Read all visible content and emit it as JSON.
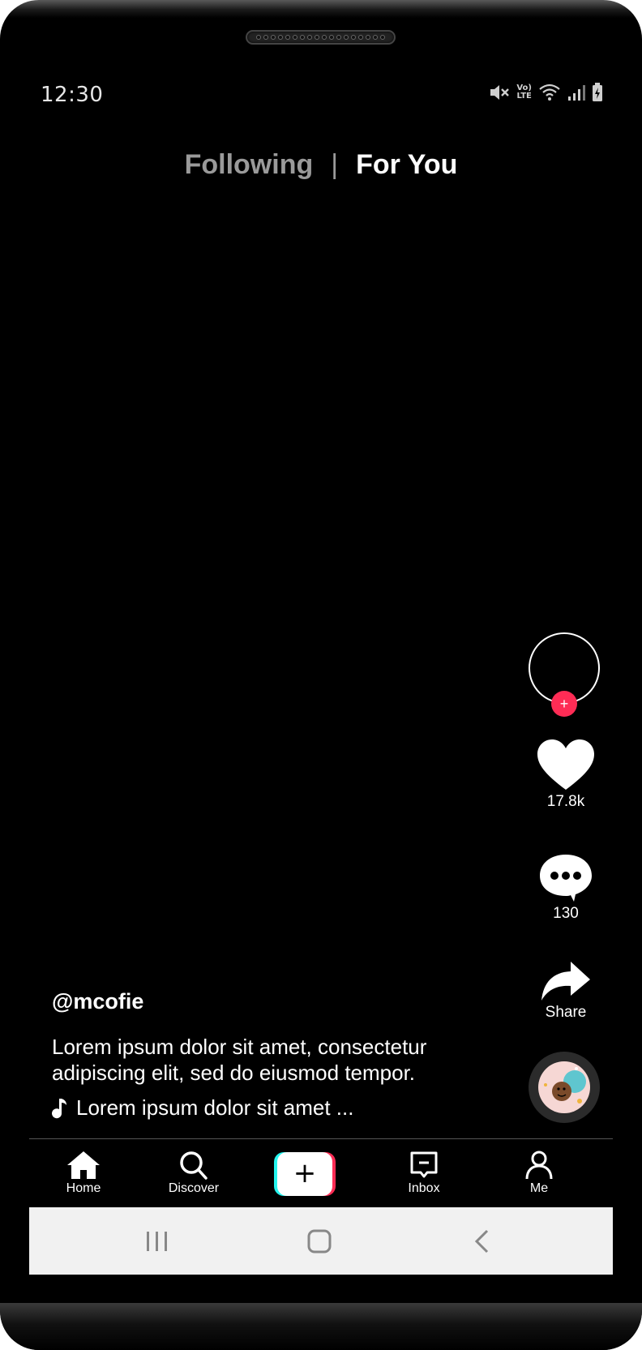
{
  "status_bar": {
    "time": "12:30",
    "volte_top": "Vo)",
    "volte_bottom": "LTE",
    "icons": [
      "mute-icon",
      "volte-icon",
      "wifi-icon",
      "signal-icon",
      "battery-charging-icon"
    ]
  },
  "feed_tabs": {
    "following": "Following",
    "separator": "|",
    "for_you": "For You",
    "active": "For You"
  },
  "actions": {
    "follow_symbol": "+",
    "likes": "17.8k",
    "comments": "130",
    "share": "Share"
  },
  "post": {
    "username": "@mcofie",
    "description": "Lorem ipsum dolor sit amet, consectetur adipiscing elit, sed do eiusmod tempor.",
    "sound": "Lorem ipsum dolor sit amet ..."
  },
  "bottom_nav": {
    "home": "Home",
    "discover": "Discover",
    "create_symbol": "+",
    "inbox": "Inbox",
    "me": "Me"
  },
  "colors": {
    "background": "#000000",
    "accent_pink": "#fe2c55",
    "accent_cyan": "#25f4ee",
    "inactive_tab": "#9a9a9a",
    "system_nav": "#f1f1f1"
  }
}
